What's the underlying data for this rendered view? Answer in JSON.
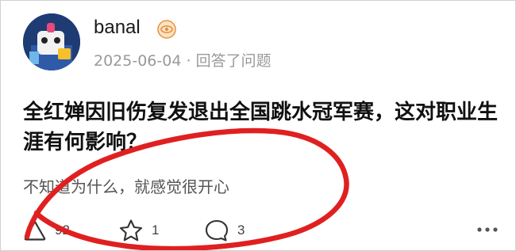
{
  "author": {
    "name": "banal",
    "badge_icon": "eye-badge-icon",
    "badge_color": "#e8923a"
  },
  "meta": {
    "date": "2025-06-04",
    "separator": "·",
    "action": "回答了问题"
  },
  "question": {
    "title": "全红婵因旧伤复发退出全国跳水冠军赛，这对职业生涯有何影响？"
  },
  "answer": {
    "excerpt": "不知道为什么，就感觉很开心"
  },
  "actions": {
    "upvote": {
      "icon": "upvote-triangle-icon",
      "count": "92"
    },
    "favorite": {
      "icon": "star-icon",
      "count": "1"
    },
    "comment": {
      "icon": "comment-bubble-icon",
      "count": "3"
    },
    "more": {
      "icon": "more-dots-icon"
    }
  },
  "annotation": {
    "color": "#e02020",
    "shape": "hand-drawn-circle"
  }
}
